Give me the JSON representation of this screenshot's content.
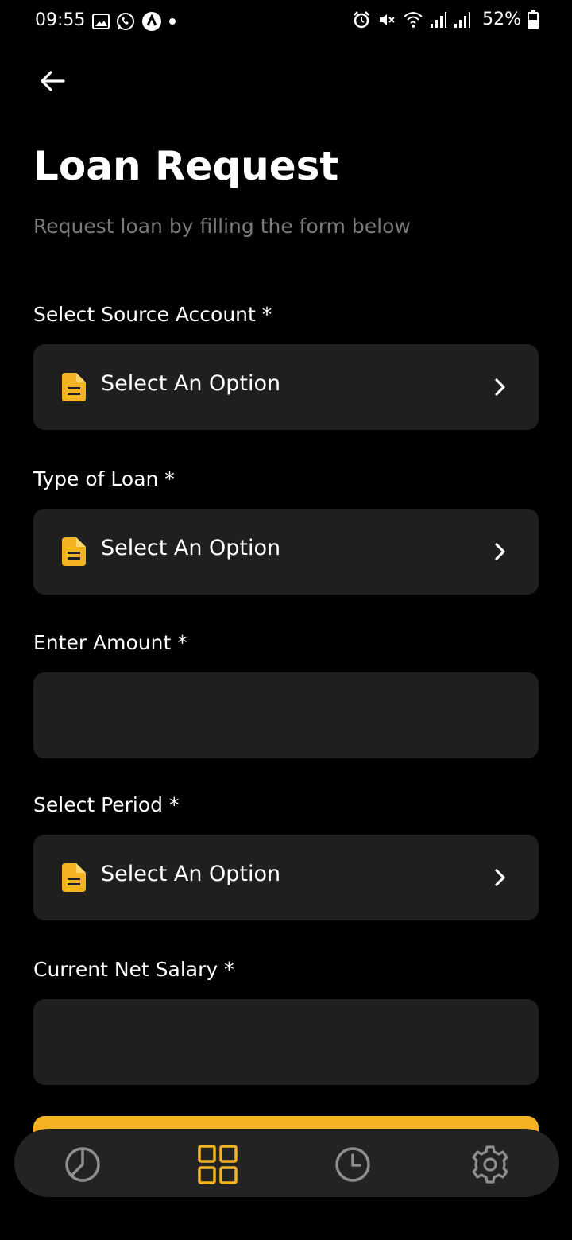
{
  "status_bar": {
    "time": "09:55",
    "battery": "52%"
  },
  "header": {
    "title": "Loan Request",
    "subtitle": "Request loan by filling the form below"
  },
  "form": {
    "source_account": {
      "label": "Select Source Account *",
      "value": "Select An Option"
    },
    "loan_type": {
      "label": "Type of Loan *",
      "value": "Select An Option"
    },
    "amount": {
      "label": "Enter Amount *",
      "value": ""
    },
    "period": {
      "label": "Select Period *",
      "value": "Select An Option"
    },
    "salary": {
      "label": "Current Net Salary *",
      "value": ""
    }
  },
  "nav": {
    "items": [
      "pie-chart-icon",
      "grid-icon",
      "clock-icon",
      "gear-icon"
    ],
    "active": "grid-icon"
  },
  "colors": {
    "accent": "#f4b323",
    "field_bg": "#1f1f1f",
    "nav_bg": "#232323",
    "subtitle": "#7a7a7a"
  }
}
